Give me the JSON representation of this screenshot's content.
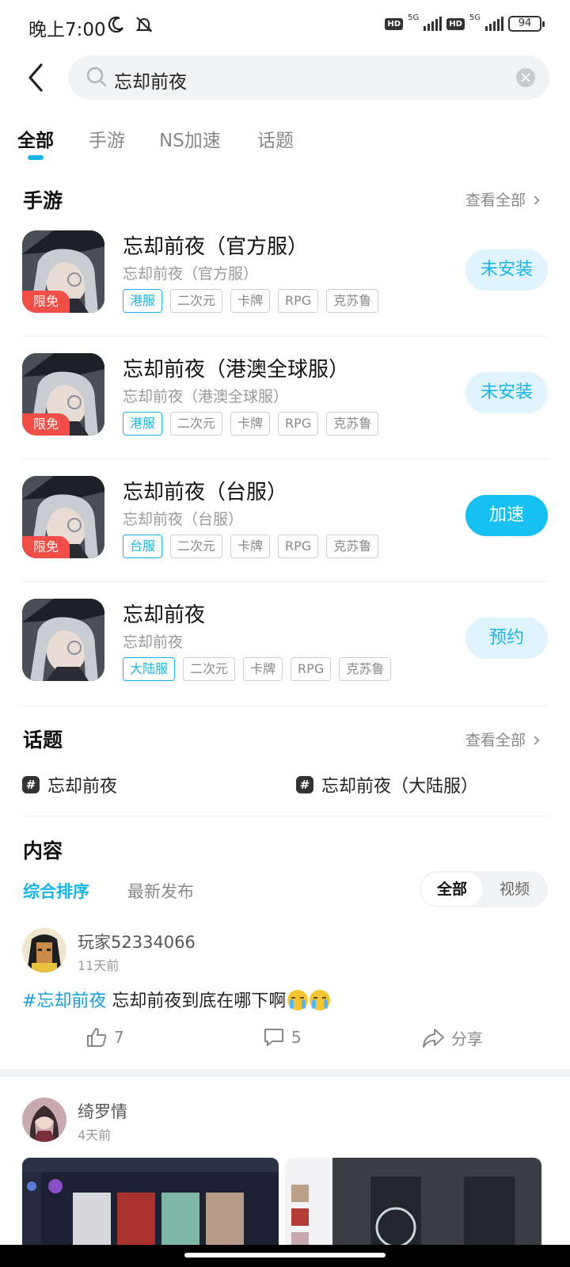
{
  "status": {
    "time": "晚上7:00",
    "net1": "5G",
    "net2": "5G",
    "hd": "HD",
    "battery": "94"
  },
  "search": {
    "query": "忘却前夜"
  },
  "tabs": [
    {
      "label": "全部",
      "active": true
    },
    {
      "label": "手游",
      "active": false
    },
    {
      "label": "NS加速",
      "active": false
    },
    {
      "label": "话题",
      "active": false
    }
  ],
  "games_section": {
    "title": "手游",
    "more": "查看全部"
  },
  "games": [
    {
      "name": "忘却前夜（官方服）",
      "sub": "忘却前夜（官方服）",
      "badge": "限免",
      "tags": [
        "港服",
        "二次元",
        "卡牌",
        "RPG",
        "克苏鲁"
      ],
      "action": "未安装",
      "action_style": "light"
    },
    {
      "name": "忘却前夜（港澳全球服）",
      "sub": "忘却前夜（港澳全球服）",
      "badge": "限免",
      "tags": [
        "港服",
        "二次元",
        "卡牌",
        "RPG",
        "克苏鲁"
      ],
      "action": "未安装",
      "action_style": "light"
    },
    {
      "name": "忘却前夜（台服）",
      "sub": "忘却前夜（台服）",
      "badge": "限免",
      "tags": [
        "台服",
        "二次元",
        "卡牌",
        "RPG",
        "克苏鲁"
      ],
      "action": "加速",
      "action_style": "solid"
    },
    {
      "name": "忘却前夜",
      "sub": "忘却前夜",
      "badge": "",
      "tags": [
        "大陆服",
        "二次元",
        "卡牌",
        "RPG",
        "克苏鲁"
      ],
      "action": "预约",
      "action_style": "light"
    }
  ],
  "topics_section": {
    "title": "话题",
    "more": "查看全部"
  },
  "topics": [
    "忘却前夜",
    "忘却前夜（大陆服）"
  ],
  "content_section": {
    "title": "内容",
    "sort_active": "综合排序",
    "sort_inactive": "最新发布",
    "filter_on": "全部",
    "filter_off": "视频"
  },
  "posts": [
    {
      "user": "玩家52334066",
      "time": "11天前",
      "hashtag": "#忘却前夜",
      "text": " 忘却前夜到底在哪下啊",
      "likes": "7",
      "comments": "5",
      "share": "分享"
    },
    {
      "user": "绮罗情",
      "time": "4天前"
    }
  ],
  "colors": {
    "accent": "#17b5e8",
    "badge": "#f04e47"
  }
}
